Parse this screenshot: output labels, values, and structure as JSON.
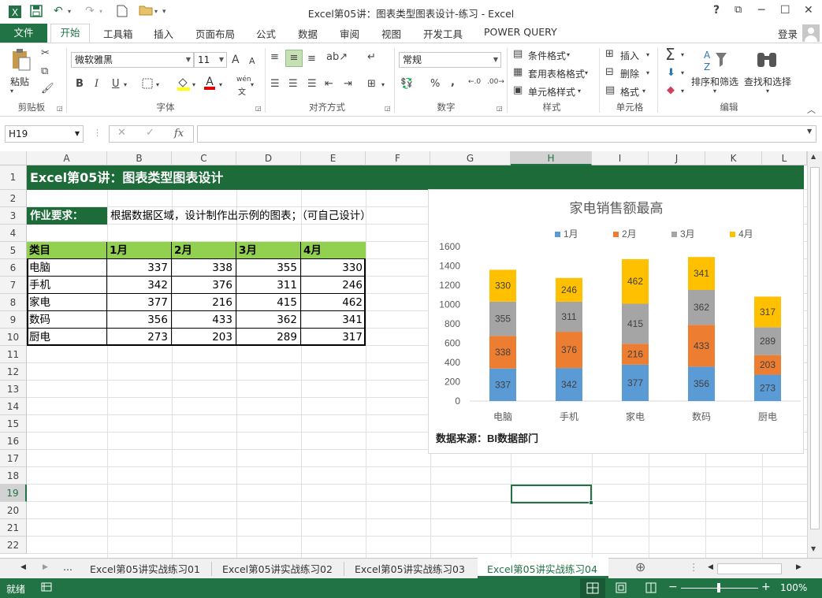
{
  "window": {
    "title": "Excel第05讲：图表类型图表设计-练习 - Excel",
    "help": "?",
    "restore_ribbon": "⧉",
    "minimize": "─",
    "maximize": "☐",
    "close": "✕"
  },
  "quick_access": {
    "save_icon": "save-icon",
    "undo_icon": "undo-icon",
    "redo_icon": "redo-icon",
    "new_icon": "new-file-icon",
    "open_icon": "open-folder-icon"
  },
  "tabs": {
    "file": "文件",
    "home": "开始",
    "items": [
      "工具箱",
      "插入",
      "页面布局",
      "公式",
      "数据",
      "审阅",
      "视图",
      "开发工具",
      "POWER QUERY"
    ],
    "login": "登录"
  },
  "ribbon": {
    "clipboard": {
      "paste": "粘贴",
      "label": "剪贴板"
    },
    "font": {
      "name": "微软雅黑",
      "size": "11",
      "bold": "B",
      "italic": "I",
      "underline": "U",
      "grow": "A",
      "shrink": "A",
      "wen": "wén",
      "label": "字体"
    },
    "alignment": {
      "label": "对齐方式"
    },
    "number": {
      "format": "常规",
      "percent": "%",
      "comma": ",",
      "label": "数字"
    },
    "styles": {
      "conditional": "条件格式",
      "table": "套用表格格式",
      "cell": "单元格样式",
      "label": "样式"
    },
    "cells": {
      "insert": "插入",
      "delete": "删除",
      "format": "格式",
      "label": "单元格"
    },
    "editing": {
      "sort": "排序和筛选",
      "find": "查找和选择",
      "label": "编辑"
    }
  },
  "formula_bar": {
    "name_box": "H19",
    "cancel": "✕",
    "confirm": "✓",
    "fx": "fx",
    "value": ""
  },
  "columns": [
    "A",
    "B",
    "C",
    "D",
    "E",
    "F",
    "G",
    "H",
    "I",
    "J",
    "K",
    "L"
  ],
  "rows": [
    "1",
    "2",
    "3",
    "4",
    "5",
    "6",
    "7",
    "8",
    "9",
    "10",
    "11",
    "12",
    "13",
    "14",
    "15",
    "16",
    "17",
    "18",
    "19",
    "20",
    "21",
    "22"
  ],
  "sheet": {
    "title": "Excel第05讲：图表类型图表设计",
    "requirement_label": "作业要求：",
    "requirement_text": "根据数据区域，设计制作出示例的图表；（可自己设计）",
    "table": {
      "headers": [
        "类目",
        "1月",
        "2月",
        "3月",
        "4月"
      ],
      "rows": [
        [
          "电脑",
          "337",
          "338",
          "355",
          "330"
        ],
        [
          "手机",
          "342",
          "376",
          "311",
          "246"
        ],
        [
          "家电",
          "377",
          "216",
          "415",
          "462"
        ],
        [
          "数码",
          "356",
          "433",
          "362",
          "341"
        ],
        [
          "厨电",
          "273",
          "203",
          "289",
          "317"
        ]
      ]
    }
  },
  "chart_data": {
    "type": "bar",
    "stacked": true,
    "title": "家电销售额最高",
    "categories": [
      "电脑",
      "手机",
      "家电",
      "数码",
      "厨电"
    ],
    "series": [
      {
        "name": "1月",
        "values": [
          337,
          342,
          377,
          356,
          273
        ],
        "color": "#5B9BD5"
      },
      {
        "name": "2月",
        "values": [
          338,
          376,
          216,
          433,
          203
        ],
        "color": "#ED7D31"
      },
      {
        "name": "3月",
        "values": [
          355,
          311,
          415,
          362,
          289
        ],
        "color": "#A5A5A5"
      },
      {
        "name": "4月",
        "values": [
          330,
          246,
          462,
          341,
          317
        ],
        "color": "#FFC000"
      }
    ],
    "ylim": [
      0,
      1600
    ],
    "yticks": [
      "0",
      "200",
      "400",
      "600",
      "800",
      "1000",
      "1200",
      "1400",
      "1600"
    ],
    "legend_position": "top",
    "grid": false,
    "source_note": "数据来源：BI数据部门"
  },
  "sheet_tabs": {
    "more": "...",
    "tabs": [
      "Excel第05讲实战练习01",
      "Excel第05讲实战练习02",
      "Excel第05讲实战练习03",
      "Excel第05讲实战练习04"
    ],
    "active_index": 3
  },
  "status": {
    "ready": "就绪",
    "zoom": "100%"
  },
  "colors": {
    "excel_green": "#217346",
    "header_green": "#1E6B3A",
    "table_header": "#92D050"
  }
}
